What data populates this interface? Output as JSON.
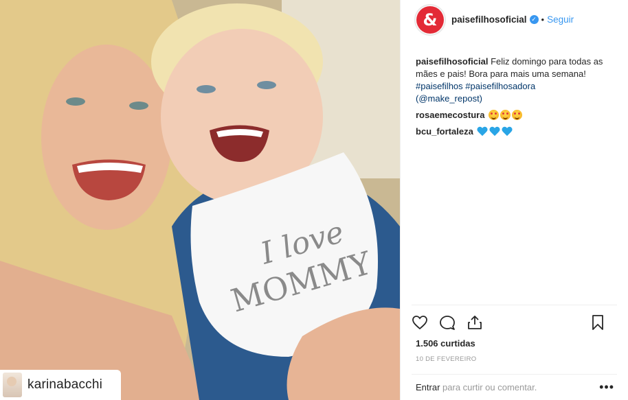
{
  "photo": {
    "repost_user": "karinabacchi",
    "bib_line1": "I love",
    "bib_line2": "MOMMY"
  },
  "header": {
    "avatar_glyph": "&",
    "username": "paisefilhosoficial",
    "verified_glyph": "✓",
    "separator": "•",
    "follow_label": "Seguir"
  },
  "caption": {
    "username": "paisefilhosoficial",
    "text": "Feliz domingo para todas as mães e pais! Bora para mais uma semana!",
    "hashtags": [
      "#paisefilhos",
      "#paisefilhosadora"
    ],
    "credit": "(@make_repost)"
  },
  "comments": [
    {
      "username": "rosaemecostura",
      "emoji": "smiling-face-with-heart-eyes",
      "count": 3
    },
    {
      "username": "bcu_fortaleza",
      "emoji": "blue-heart",
      "count": 3
    }
  ],
  "actions": {
    "icons": [
      "heart-icon",
      "comment-icon",
      "share-icon",
      "bookmark-icon"
    ]
  },
  "likes_label": "1.506 curtidas",
  "date_label": "10 de fevereiro",
  "add_comment": {
    "login_label": "Entrar",
    "rest_label": "para curtir ou comentar.",
    "more_glyph": "•••"
  },
  "colors": {
    "link_blue": "#3897f0",
    "hashtag": "#003569",
    "brand_red": "#e32a36",
    "muted": "#999999"
  }
}
